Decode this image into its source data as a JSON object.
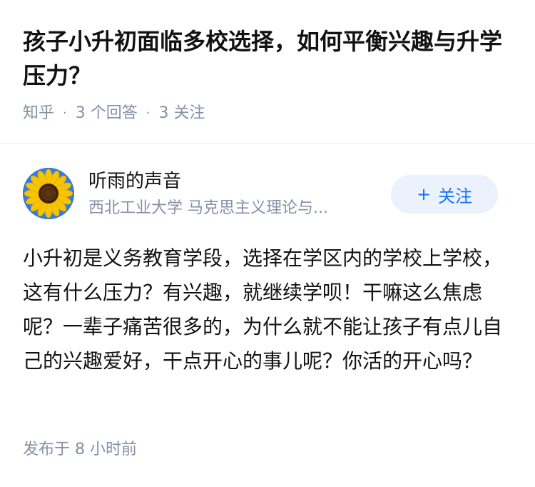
{
  "question": {
    "title": "孩子小升初面临多校选择，如何平衡兴趣与升学压力？",
    "source": "知乎",
    "answers_count": "3 个回答",
    "followers_count": "3 关注",
    "separator": "·"
  },
  "answer": {
    "author": {
      "name": "听雨的声音",
      "headline": "西北工业大学 马克思主义理论与...",
      "avatar": "sunflower-avatar"
    },
    "follow_button": {
      "icon": "+",
      "label": "关注"
    },
    "content": "小升初是义务教育学段，选择在学区内的学校上学校，这有什么压力？有兴趣，就继续学呗！干嘛这么焦虑呢？一辈子痛苦很多的，为什么就不能让孩子有点儿自己的兴趣爱好，干点开心的事儿呢？你活的开心吗？",
    "published": "发布于 8 小时前"
  },
  "colors": {
    "title": "#121212",
    "meta": "#8590a6",
    "accent": "#1772f6",
    "button_bg": "#ebf2fc",
    "divider": "#ececec"
  }
}
